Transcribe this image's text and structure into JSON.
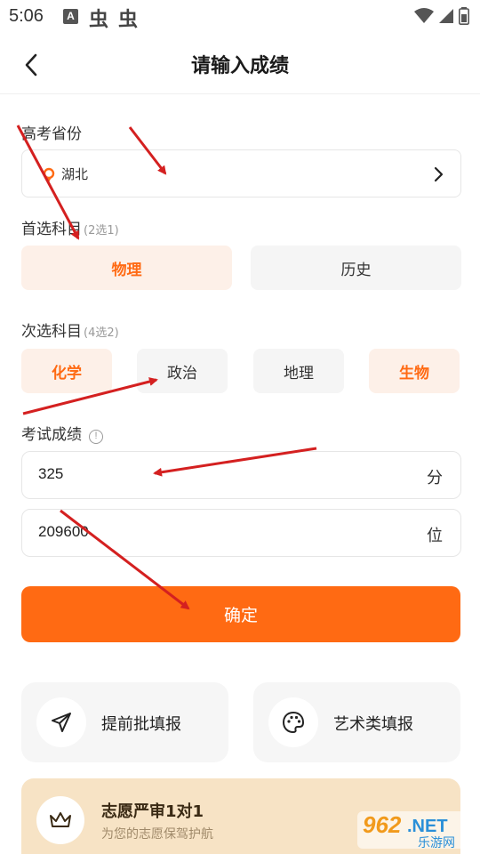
{
  "status_bar": {
    "time": "5:06",
    "notif_a": "A",
    "bug1": "虫",
    "bug2": "虫"
  },
  "header": {
    "title": "请输入成绩"
  },
  "province": {
    "label": "高考省份",
    "value": "湖北"
  },
  "first_subject": {
    "label": "首选科目",
    "hint": "(2选1)",
    "options": [
      {
        "label": "物理",
        "selected": true
      },
      {
        "label": "历史",
        "selected": false
      }
    ]
  },
  "second_subject": {
    "label": "次选科目",
    "hint": "(4选2)",
    "options": [
      {
        "label": "化学",
        "selected": true
      },
      {
        "label": "政治",
        "selected": false
      },
      {
        "label": "地理",
        "selected": false
      },
      {
        "label": "生物",
        "selected": true
      }
    ]
  },
  "exam": {
    "label": "考试成绩",
    "info_glyph": "!",
    "score": {
      "value": "325",
      "unit": "分"
    },
    "rank": {
      "value": "209600",
      "unit": "位"
    }
  },
  "confirm_label": "确定",
  "features": [
    {
      "label": "提前批填报",
      "icon": "send-icon"
    },
    {
      "label": "艺术类填报",
      "icon": "palette-icon"
    }
  ],
  "promo": {
    "title_prefix": "志愿严审",
    "title_bold1": "1",
    "title_mid": "对",
    "title_bold2": "1",
    "subtitle": "为您的志愿保驾护航"
  },
  "watermark": {
    "brand": "962.NET",
    "sub": "乐游网"
  },
  "colors": {
    "accent": "#ff6a13",
    "accent_soft": "#fdf0e8",
    "promo_bg": "#f7e3c5",
    "annotation_arrow": "#d42020"
  }
}
